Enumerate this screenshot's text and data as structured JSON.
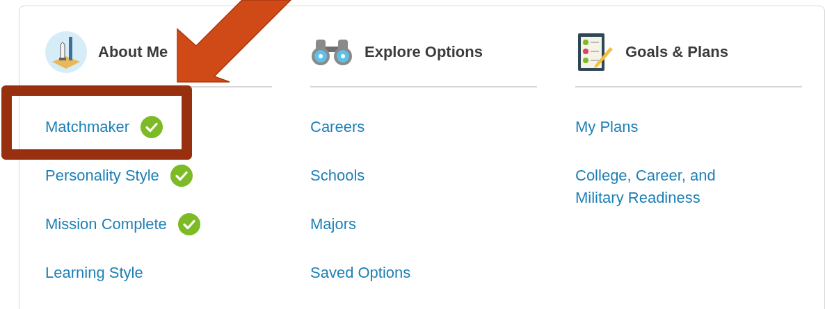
{
  "columns": [
    {
      "kind": "rocket",
      "title": "About Me",
      "items": [
        {
          "label": "Matchmaker",
          "done": true
        },
        {
          "label": "Personality Style",
          "done": true
        },
        {
          "label": "Mission Complete",
          "done": true
        },
        {
          "label": "Learning Style",
          "done": false
        }
      ]
    },
    {
      "kind": "binoculars",
      "title": "Explore Options",
      "items": [
        {
          "label": "Careers",
          "done": false
        },
        {
          "label": "Schools",
          "done": false
        },
        {
          "label": "Majors",
          "done": false
        },
        {
          "label": "Saved Options",
          "done": false
        }
      ]
    },
    {
      "kind": "clipboard",
      "title": "Goals & Plans",
      "items": [
        {
          "label": "My Plans",
          "done": false
        },
        {
          "label": "College, Career, and Military Readiness",
          "done": false
        }
      ]
    }
  ]
}
